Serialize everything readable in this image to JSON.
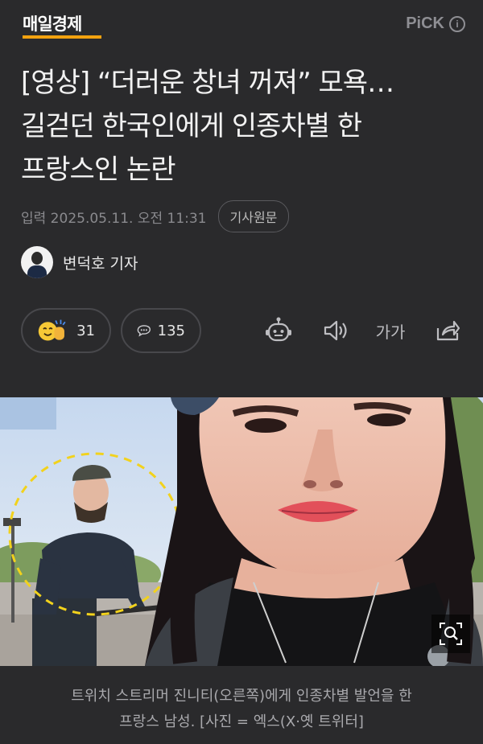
{
  "header": {
    "logo": "매일경제",
    "pick_label": "PiCK",
    "info_icon": "i"
  },
  "article": {
    "headline_lines": [
      "[영상] “더러운 창녀 꺼져” 모욕…",
      "길걷던 한국인에게 인종차별 한",
      "프랑스인 논란"
    ],
    "published": "입력 2025.05.11. 오전 11:31",
    "original_button": "기사원문",
    "reporter": "변덕호 기자"
  },
  "actions": {
    "reaction_count": "31",
    "comment_count": "135",
    "font_size_label": "가가"
  },
  "photo": {
    "caption_lines": [
      "트위치 스트리머 진니티(오른쪽)에게 인종차별 발언을 한",
      "프랑스 남성. [사진 = 엑스(X·옛 트위터]"
    ]
  },
  "colors": {
    "background": "#2a2a2c",
    "accent": "#f3a20f",
    "muted_text": "#8a8a8e"
  }
}
